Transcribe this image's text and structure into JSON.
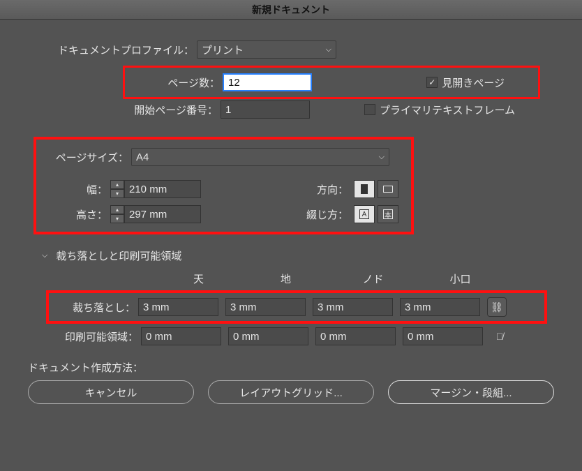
{
  "title": "新規ドキュメント",
  "profile": {
    "label": "ドキュメントプロファイル：",
    "value": "プリント"
  },
  "pages": {
    "label": "ページ数：",
    "value": "12",
    "facing_label": "見開きページ"
  },
  "start": {
    "label": "開始ページ番号：",
    "value": "1",
    "primary_label": "プライマリテキストフレーム"
  },
  "size": {
    "label": "ページサイズ：",
    "value": "A4"
  },
  "width": {
    "label": "幅：",
    "value": "210 mm"
  },
  "height": {
    "label": "高さ：",
    "value": "297 mm"
  },
  "orient": {
    "label": "方向："
  },
  "bind": {
    "label": "綴じ方：",
    "a": "A",
    "b": "本"
  },
  "bleed_section": "裁ち落としと印刷可能領域",
  "headers": {
    "top": "天",
    "bottom": "地",
    "inside": "ノド",
    "outside": "小口"
  },
  "bleed": {
    "label": "裁ち落とし：",
    "v": "3 mm"
  },
  "slug": {
    "label": "印刷可能領域：",
    "v": "0 mm"
  },
  "create_label": "ドキュメント作成方法：",
  "buttons": {
    "cancel": "キャンセル",
    "grid": "レイアウトグリッド...",
    "margin": "マージン・段組..."
  }
}
